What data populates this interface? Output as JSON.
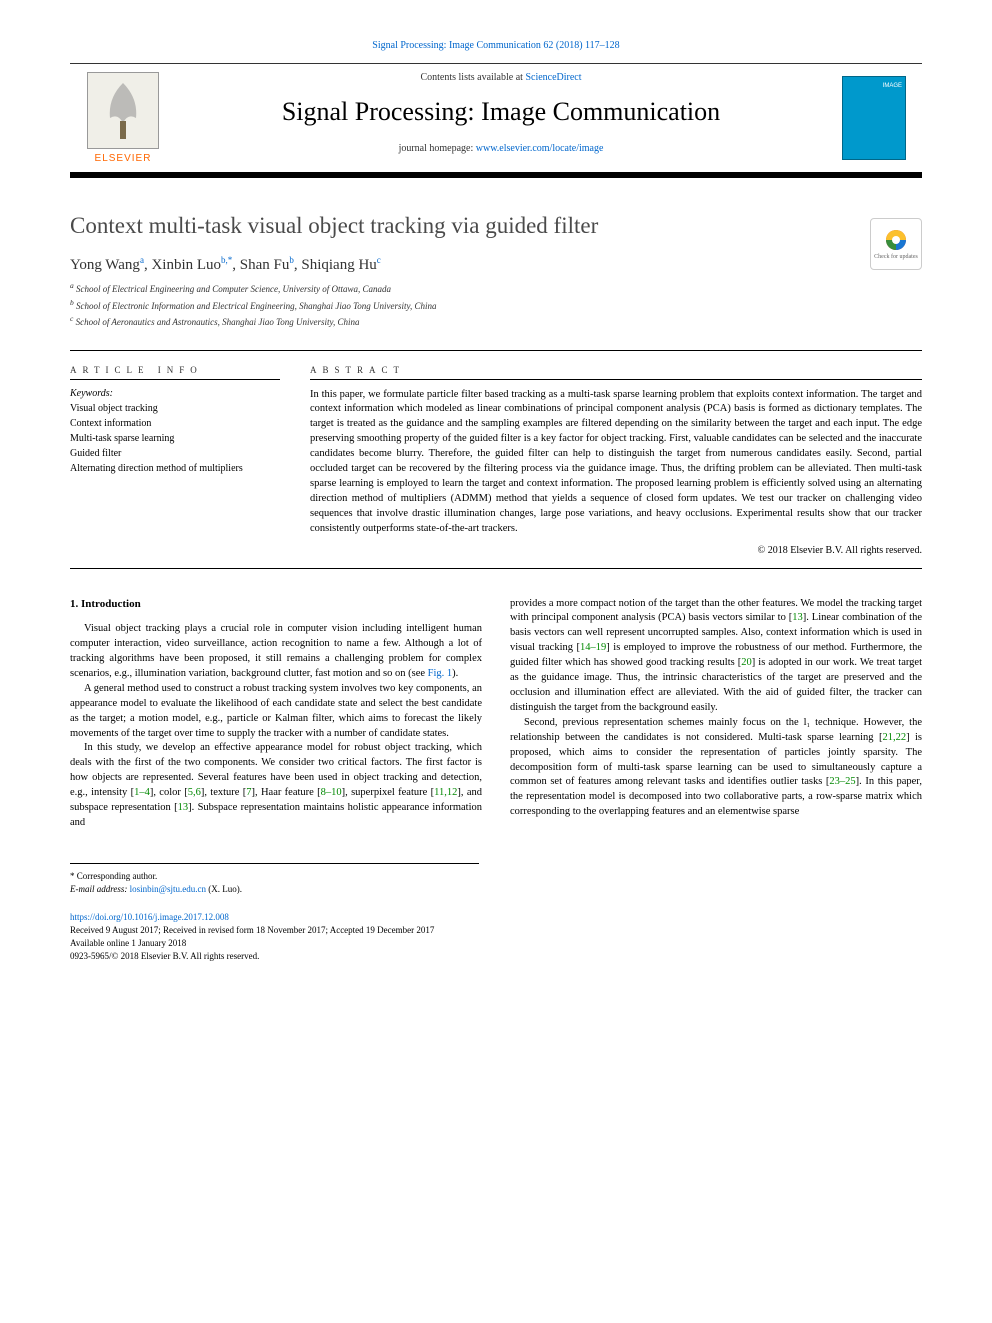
{
  "header": {
    "citation": "Signal Processing: Image Communication 62 (2018) 117–128",
    "contents_prefix": "Contents lists available at ",
    "contents_link": "ScienceDirect",
    "journal_name": "Signal Processing: Image Communication",
    "homepage_prefix": "journal homepage: ",
    "homepage_link": "www.elsevier.com/locate/image",
    "publisher_name": "ELSEVIER",
    "cover_label": "IMAGE"
  },
  "article": {
    "title": "Context multi-task visual object tracking via guided filter",
    "authors_html": "Yong Wang",
    "authors": [
      {
        "name": "Yong Wang",
        "aff": "a"
      },
      {
        "name": "Xinbin Luo",
        "aff": "b,*"
      },
      {
        "name": "Shan Fu",
        "aff": "b"
      },
      {
        "name": "Shiqiang Hu",
        "aff": "c"
      }
    ],
    "affiliations": [
      "School of Electrical Engineering and Computer Science, University of Ottawa, Canada",
      "School of Electronic Information and Electrical Engineering, Shanghai Jiao Tong University, China",
      "School of Aeronautics and Astronautics, Shanghai Jiao Tong University, China"
    ],
    "check_updates": "Check for updates"
  },
  "info": {
    "heading": "ARTICLE INFO",
    "keywords_label": "Keywords:",
    "keywords": [
      "Visual object tracking",
      "Context information",
      "Multi-task sparse learning",
      "Guided filter",
      "Alternating direction method of multipliers"
    ]
  },
  "abstract": {
    "heading": "ABSTRACT",
    "text": "In this paper, we formulate particle filter based tracking as a multi-task sparse learning problem that exploits context information. The target and context information which modeled as linear combinations of principal component analysis (PCA) basis is formed as dictionary templates. The target is treated as the guidance and the sampling examples are filtered depending on the similarity between the target and each input. The edge preserving smoothing property of the guided filter is a key factor for object tracking. First, valuable candidates can be selected and the inaccurate candidates become blurry. Therefore, the guided filter can help to distinguish the target from numerous candidates easily. Second, partial occluded target can be recovered by the filtering process via the guidance image. Thus, the drifting problem can be alleviated. Then multi-task sparse learning is employed to learn the target and context information. The proposed learning problem is efficiently solved using an alternating direction method of multipliers (ADMM) method that yields a sequence of closed form updates. We test our tracker on challenging video sequences that involve drastic illumination changes, large pose variations, and heavy occlusions. Experimental results show that our tracker consistently outperforms state-of-the-art trackers.",
    "copyright": "© 2018 Elsevier B.V. All rights reserved."
  },
  "body": {
    "section_number": "1.",
    "section_title": "Introduction",
    "col1": {
      "p1": "Visual object tracking plays a crucial role in computer vision including intelligent human computer interaction, video surveillance, action recognition to name a few. Although a lot of tracking algorithms have been proposed, it still remains a challenging problem for complex scenarios, e.g., illumination variation, background clutter, fast motion and so on (see ",
      "fig1": "Fig. 1",
      "p1_end": ").",
      "p2": "A general method used to construct a robust tracking system involves two key components, an appearance model to evaluate the likelihood of each candidate state and select the best candidate as the target; a motion model, e.g., particle or Kalman filter, which aims to forecast the likely movements of the target over time to supply the tracker with a number of candidate states.",
      "p3_a": "In this study, we develop an effective appearance model for robust object tracking, which deals with the first of the two components. We consider two critical factors. The first factor is how objects are represented. Several features have been used in object tracking and detection, e.g., intensity [",
      "r1": "1–4",
      "p3_b": "], color [",
      "r2": "5,6",
      "p3_c": "], texture [",
      "r3": "7",
      "p3_d": "], Haar feature [",
      "r4": "8–10",
      "p3_e": "], superpixel feature [",
      "r5": "11,12",
      "p3_f": "], and subspace representation [",
      "r6": "13",
      "p3_g": "]. Subspace representation maintains holistic appearance information and"
    },
    "col2": {
      "p1_a": "provides a more compact notion of the target than the other features. We model the tracking target with principal component analysis (PCA) basis vectors similar to [",
      "r1": "13",
      "p1_b": "]. Linear combination of the basis vectors can well represent uncorrupted samples. Also, context information which is used in visual tracking [",
      "r2": "14–19",
      "p1_c": "] is employed to improve the robustness of our method. Furthermore, the guided filter which has showed good tracking results [",
      "r3": "20",
      "p1_d": "] is adopted in our work. We treat target as the guidance image. Thus, the intrinsic characteristics of the target are preserved and the occlusion and illumination effect are alleviated. With the aid of guided filter, the tracker can distinguish the target from the background easily.",
      "p2_a": "Second, previous representation schemes mainly focus on the l₁ technique. However, the relationship between the candidates is not considered. Multi-task sparse learning [",
      "r4": "21,22",
      "p2_b": "] is proposed, which aims to consider the representation of particles jointly sparsity. The decomposition form of multi-task sparse learning can be used to simultaneously capture a common set of features among relevant tasks and identifies outlier tasks [",
      "r5": "23–25",
      "p2_c": "]. In this paper, the representation model is decomposed into two collaborative parts, a row-sparse matrix which corresponding to the overlapping features and an elementwise sparse"
    }
  },
  "footnotes": {
    "corr": "* Corresponding author.",
    "email_label": "E-mail address: ",
    "email": "losinbin@sjtu.edu.cn",
    "email_suffix": " (X. Luo)."
  },
  "doi": {
    "link": "https://doi.org/10.1016/j.image.2017.12.008",
    "received": "Received 9 August 2017; Received in revised form 18 November 2017; Accepted 19 December 2017",
    "available": "Available online 1 January 2018",
    "issn": "0923-5965/© 2018 Elsevier B.V. All rights reserved."
  }
}
